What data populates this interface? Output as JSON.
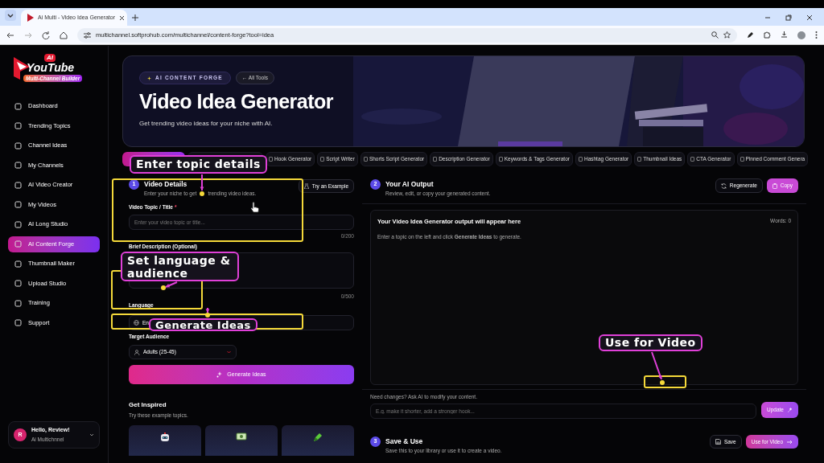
{
  "browser": {
    "tab_title": "Ai Multi - Video Idea Generator",
    "url": "multichannel.softprohub.com/multichannel/content-forge?tool=idea"
  },
  "sidebar": {
    "logo": {
      "badge": "AI",
      "name": "YouTube",
      "tagline": "Multi-Channel Builder"
    },
    "items": [
      {
        "label": "Dashboard",
        "selected": false
      },
      {
        "label": "Trending Topics",
        "selected": false
      },
      {
        "label": "Channel Ideas",
        "selected": false
      },
      {
        "label": "My Channels",
        "selected": false
      },
      {
        "label": "AI Video Creator",
        "selected": false
      },
      {
        "label": "My Videos",
        "selected": false
      },
      {
        "label": "AI Long Studio",
        "selected": false
      },
      {
        "label": "AI Content Forge",
        "selected": true
      },
      {
        "label": "Thumbnail Maker",
        "selected": false
      },
      {
        "label": "Upload Studio",
        "selected": false
      },
      {
        "label": "Training",
        "selected": false
      },
      {
        "label": "Support",
        "selected": false
      }
    ],
    "user": {
      "avatar": "R",
      "greeting": "Hello, Review!",
      "subtitle": "Ai Multichnnel"
    }
  },
  "hero": {
    "chip": "AI CONTENT FORGE",
    "back_link": "← All Tools",
    "title": "Video Idea Generator",
    "subtitle": "Get trending video ideas for your niche with AI."
  },
  "tool_tabs": [
    {
      "selected": true
    },
    {
      "selected": false
    },
    {
      "label": "Hook Generator",
      "selected": false
    },
    {
      "label": "Script Writer",
      "selected": false
    },
    {
      "label": "Shorts Script Generator",
      "selected": false
    },
    {
      "label": "Description Generator",
      "selected": false
    },
    {
      "label": "Keywords & Tags Generator",
      "selected": false
    },
    {
      "label": "Hashtag Generator",
      "selected": false
    },
    {
      "label": "Thumbnail Ideas",
      "selected": false
    },
    {
      "label": "CTA Generator",
      "selected": false
    },
    {
      "label": "Pinned Comment Genera",
      "selected": false
    }
  ],
  "details": {
    "step": "1",
    "title": "Video Details",
    "subtitle_start": "Enter your niche to get",
    "subtitle_end": "trending video ideas.",
    "example_button": "Try an Example",
    "topic": {
      "label": "Video Topic / Title",
      "required_mark": "*",
      "placeholder": "Enter your video topic or title...",
      "counter": "0/200"
    },
    "description": {
      "label": "Brief Description (Optional)",
      "counter": "0/500"
    },
    "language": {
      "label": "Language",
      "value": "En"
    },
    "audience": {
      "label": "Target Audience",
      "value": "Adults (25-45)"
    },
    "generate_button": "Generate Ideas",
    "inspired": {
      "title": "Get Inspired",
      "subtitle": "Try these example topics.",
      "cards": [
        {
          "kind": "robot"
        },
        {
          "kind": "money"
        },
        {
          "kind": "pen"
        }
      ]
    }
  },
  "output": {
    "step": "2",
    "title": "Your AI Output",
    "subtitle": "Review, edit, or copy your generated content.",
    "regenerate_button": "Regenerate",
    "copy_button": "Copy",
    "box_title": "Your Video Idea Generator output will appear here",
    "word_count": "Words: 0",
    "hint": "Enter a topic on the left and click **Generate Ideas** to generate.",
    "refine_label": "Need changes? Ask AI to modify your content.",
    "refine_placeholder": "E.g. make it shorter, add a stronger hook...",
    "update_button": "Update"
  },
  "save": {
    "step": "3",
    "title": "Save & Use",
    "subtitle": "Save this to your library or use it to create a video.",
    "save_button": "Save",
    "use_button": "Use for Video"
  },
  "annotations": [
    {
      "label": "Enter topic details"
    },
    {
      "label": "Set language & audience"
    },
    {
      "label": "Generate Ideas"
    },
    {
      "label": "Use for Video"
    }
  ]
}
